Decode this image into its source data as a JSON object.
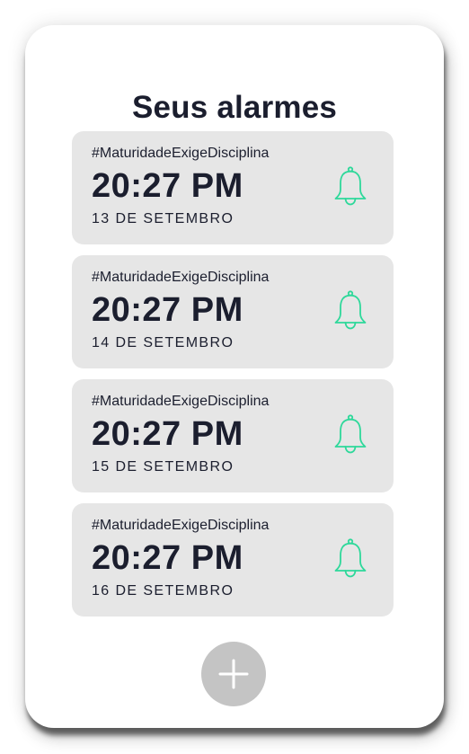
{
  "page": {
    "title": "Seus alarmes"
  },
  "alarms": [
    {
      "tag": "#MaturidadeExigeDisciplina",
      "time": "20:27 PM",
      "date": "13 DE SETEMBRO",
      "icon": "bell-icon"
    },
    {
      "tag": "#MaturidadeExigeDisciplina",
      "time": "20:27 PM",
      "date": "14 DE SETEMBRO",
      "icon": "bell-icon"
    },
    {
      "tag": "#MaturidadeExigeDisciplina",
      "time": "20:27 PM",
      "date": "15 DE SETEMBRO",
      "icon": "bell-icon"
    },
    {
      "tag": "#MaturidadeExigeDisciplina",
      "time": "20:27 PM",
      "date": "16 DE SETEMBRO",
      "icon": "bell-icon"
    }
  ],
  "add_button": {
    "icon": "plus-icon"
  },
  "colors": {
    "accent": "#2ed89a",
    "card": "#e6e6e6",
    "text": "#1b1e2e",
    "add_button": "#c4c4c4"
  }
}
